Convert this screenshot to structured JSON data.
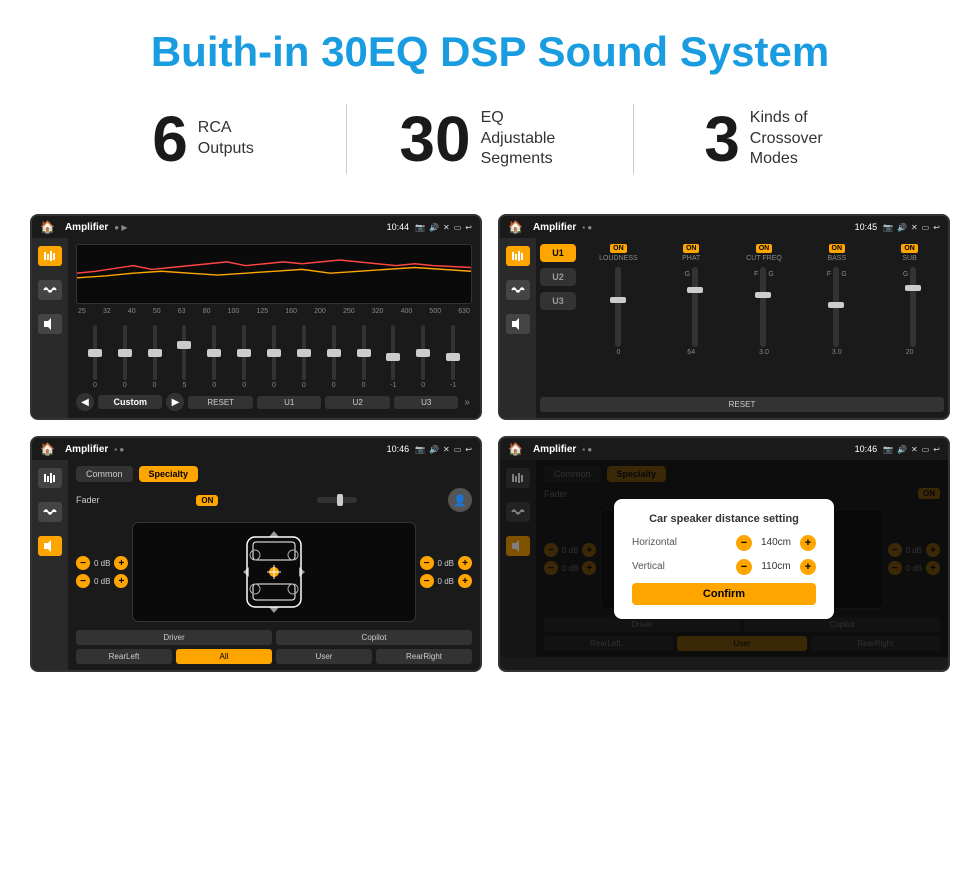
{
  "header": {
    "title": "Buith-in 30EQ DSP Sound System"
  },
  "stats": [
    {
      "number": "6",
      "text_line1": "RCA",
      "text_line2": "Outputs"
    },
    {
      "number": "30",
      "text_line1": "EQ Adjustable",
      "text_line2": "Segments"
    },
    {
      "number": "3",
      "text_line1": "Kinds of",
      "text_line2": "Crossover Modes"
    }
  ],
  "screen1": {
    "app_name": "Amplifier",
    "time": "10:44",
    "freq_labels": [
      "25",
      "32",
      "40",
      "50",
      "63",
      "80",
      "100",
      "125",
      "160",
      "200",
      "250",
      "320",
      "400",
      "500",
      "630"
    ],
    "slider_values": [
      "0",
      "0",
      "0",
      "5",
      "0",
      "0",
      "0",
      "0",
      "0",
      "0",
      "-1",
      "0",
      "-1"
    ],
    "preset_label": "Custom",
    "buttons": [
      "RESET",
      "U1",
      "U2",
      "U3"
    ]
  },
  "screen2": {
    "app_name": "Amplifier",
    "time": "10:45",
    "presets": [
      "U1",
      "U2",
      "U3"
    ],
    "channels": [
      {
        "label": "LOUDNESS",
        "on": true
      },
      {
        "label": "PHAT",
        "on": true
      },
      {
        "label": "CUT FREQ",
        "on": true
      },
      {
        "label": "BASS",
        "on": true
      },
      {
        "label": "SUB",
        "on": true
      }
    ],
    "reset_label": "RESET"
  },
  "screen3": {
    "app_name": "Amplifier",
    "time": "10:46",
    "tabs": [
      "Common",
      "Specialty"
    ],
    "fader_label": "Fader",
    "fader_on": "ON",
    "driver_label": "Driver",
    "copilot_label": "Copilot",
    "rear_left_label": "RearLeft",
    "all_label": "All",
    "user_label": "User",
    "rear_right_label": "RearRight",
    "vol_left": "0 dB",
    "vol_right": "0 dB",
    "vol_left2": "0 dB",
    "vol_right2": "0 dB"
  },
  "screen4": {
    "app_name": "Amplifier",
    "time": "10:46",
    "tabs": [
      "Common",
      "Specialty"
    ],
    "dialog": {
      "title": "Car speaker distance setting",
      "horizontal_label": "Horizontal",
      "horizontal_value": "140cm",
      "vertical_label": "Vertical",
      "vertical_value": "110cm",
      "confirm_label": "Confirm"
    },
    "driver_label": "Driver",
    "copilot_label": "Copilot",
    "rear_left_label": "RearLeft...",
    "user_label": "User",
    "rear_right_label": "RearRight",
    "vol_right": "0 dB",
    "vol_right2": "0 dB"
  }
}
